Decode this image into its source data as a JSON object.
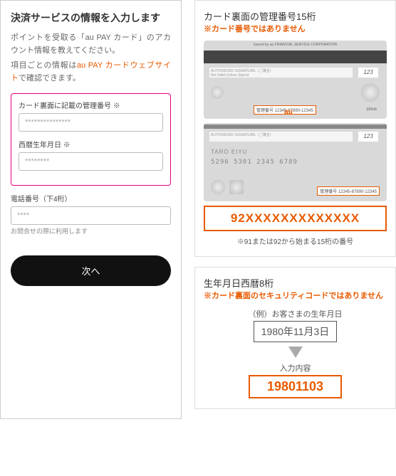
{
  "left_panel": {
    "title": "決済サービスの情報を入力します",
    "desc_prefix": "ポイントを受取る「au PAY カード」のアカウント情報を教えてください。",
    "desc_line2_prefix": "項目ごとの情報は",
    "link_text": "au PAY カードウェブサイト",
    "desc_line2_suffix": "で確認できます。",
    "fields": [
      {
        "label": "カード裏面に記載の管理番号 ※",
        "placeholder": "***************"
      },
      {
        "label": "西暦生年月日 ※",
        "placeholder": "********"
      },
      {
        "label": "電話番号（下4桁）",
        "placeholder": "****",
        "hint": "お問合せの際に利用します"
      }
    ],
    "next": "次へ"
  },
  "callout1": {
    "title": "カード裏面の管理番号15桁",
    "warn": "※カード番号ではありません",
    "card_top_text": "Issued by au FINANCIAL SERVICE CORPORATION",
    "sig_label": "AUTHORIZED SIGNATURE（ご署名）",
    "sig_sub": "Not Valid Unless Signed",
    "cvv": "123",
    "mgmt_no_sample": "管理番号  12345-87890-12345",
    "au_logo": "au",
    "cirrus": "cirrus",
    "card2_name": "TARO EIYU",
    "card2_pan": "5296 5301 2345 6789",
    "big_number": "92XXXXXXXXXXXXX",
    "note": "※91または92から始まる15桁の番号"
  },
  "callout2": {
    "title": "生年月日西暦8桁",
    "warn": "※カード裏面のセキュリティコードではありません",
    "example_label": "（例）お客さまの生年月日",
    "example_date": "1980年11月3日",
    "input_label": "入力内容",
    "result": "19801103"
  }
}
